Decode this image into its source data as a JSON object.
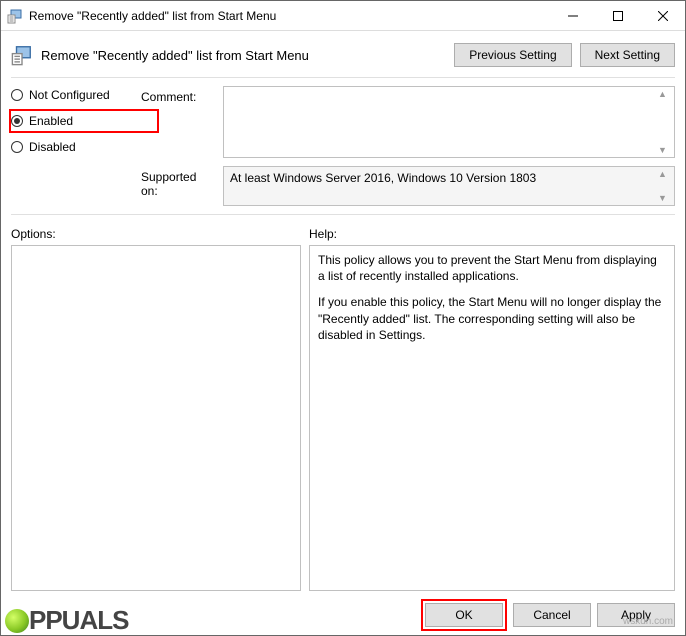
{
  "titlebar": {
    "title": "Remove \"Recently added\" list from Start Menu"
  },
  "header": {
    "title": "Remove \"Recently added\" list from Start Menu",
    "prev": "Previous Setting",
    "next": "Next Setting"
  },
  "radios": {
    "not_configured": "Not Configured",
    "enabled": "Enabled",
    "disabled": "Disabled"
  },
  "fields": {
    "comment_label": "Comment:",
    "comment_value": "",
    "supported_label": "Supported on:",
    "supported_value": "At least Windows Server 2016, Windows 10 Version 1803"
  },
  "labels": {
    "options": "Options:",
    "help": "Help:"
  },
  "help": {
    "p1": "This policy allows you to prevent the Start Menu from displaying a list of recently installed applications.",
    "p2": "If you enable this policy, the Start Menu will no longer display the \"Recently added\" list.  The corresponding setting will also be disabled in Settings."
  },
  "footer": {
    "ok": "OK",
    "cancel": "Cancel",
    "apply": "Apply"
  },
  "watermark": "wsxdn.com",
  "brand": "PPUALS"
}
